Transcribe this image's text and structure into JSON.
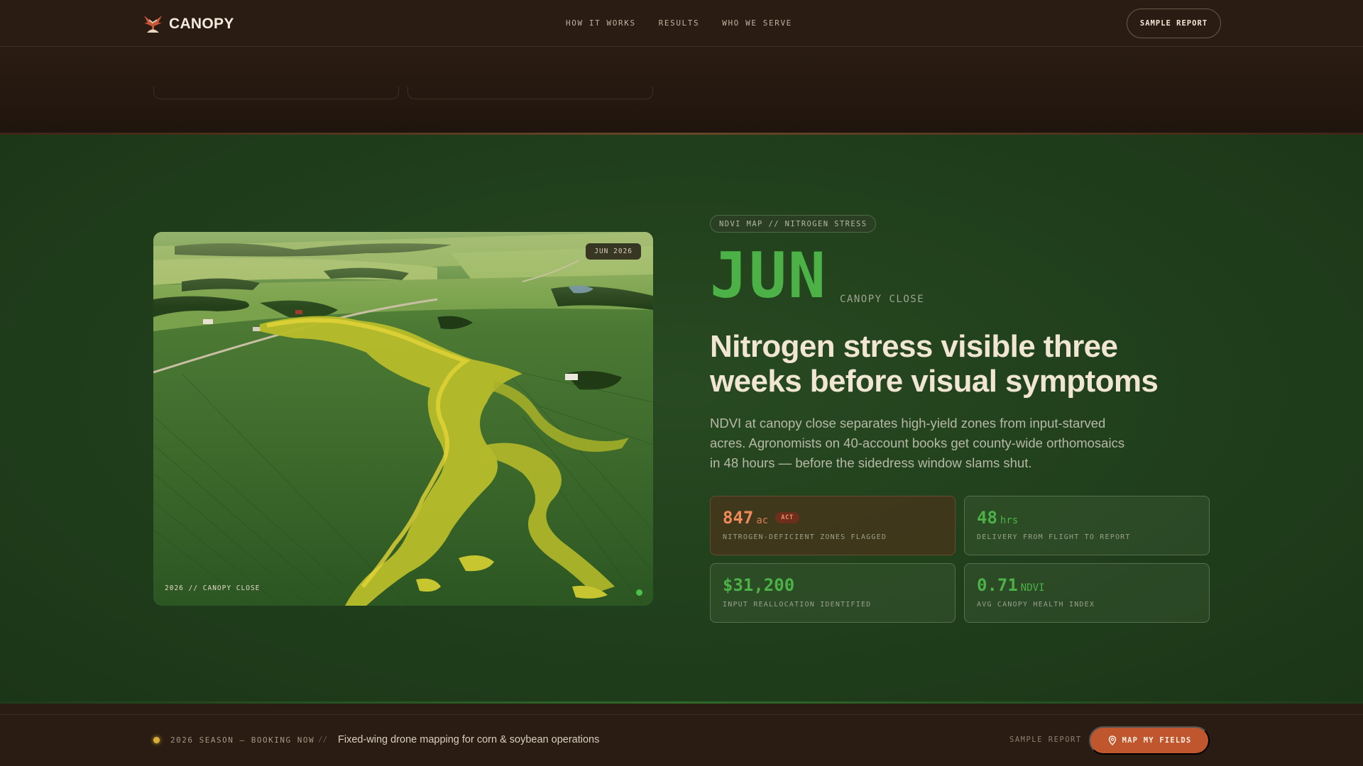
{
  "header": {
    "brand": "CANOPY",
    "nav": [
      "HOW IT WORKS",
      "RESULTS",
      "WHO WE SERVE"
    ],
    "cta_label": "SAMPLE REPORT"
  },
  "hero": {
    "tag": "NDVI MAP // NITROGEN STRESS",
    "month": "JUN",
    "month_sub": "CANOPY CLOSE",
    "headline": "Nitrogen stress visible three weeks before visual symptoms",
    "description": "NDVI at canopy close separates high-yield zones from input-starved acres. Agronomists on 40-account books get county-wide orthomosaics in 48 hours — before the sidedress window slams shut.",
    "image": {
      "badge": "JUN 2026",
      "caption": "2026 // CANOPY CLOSE"
    }
  },
  "stats": [
    {
      "value": "847",
      "unit": "ac",
      "badge": "ACT",
      "label": "NITROGEN-DEFICIENT ZONES FLAGGED",
      "color": "#f08a5a"
    },
    {
      "value": "48",
      "unit": "hrs",
      "badge": "",
      "label": "DELIVERY FROM FLIGHT TO REPORT",
      "color": "#4cb247"
    },
    {
      "value": "$31,200",
      "unit": "",
      "badge": "",
      "label": "INPUT REALLOCATION IDENTIFIED",
      "color": "#4cb247"
    },
    {
      "value": "0.71",
      "unit": "NDVI",
      "badge": "",
      "label": "AVG CANOPY HEALTH INDEX",
      "color": "#4cb247"
    }
  ],
  "bottom_bar": {
    "season": "2026 SEASON — BOOKING NOW",
    "separator": "//",
    "text": "Fixed-wing drone mapping for corn & soybean operations",
    "sample_link": "SAMPLE REPORT",
    "cta_label": "MAP MY FIELDS",
    "cta_icon": "map-pin-icon"
  },
  "colors": {
    "accent_green": "#4cb247",
    "accent_orange": "#c0562e",
    "background_dark": "#2a1c12",
    "background_green": "#21401c"
  }
}
